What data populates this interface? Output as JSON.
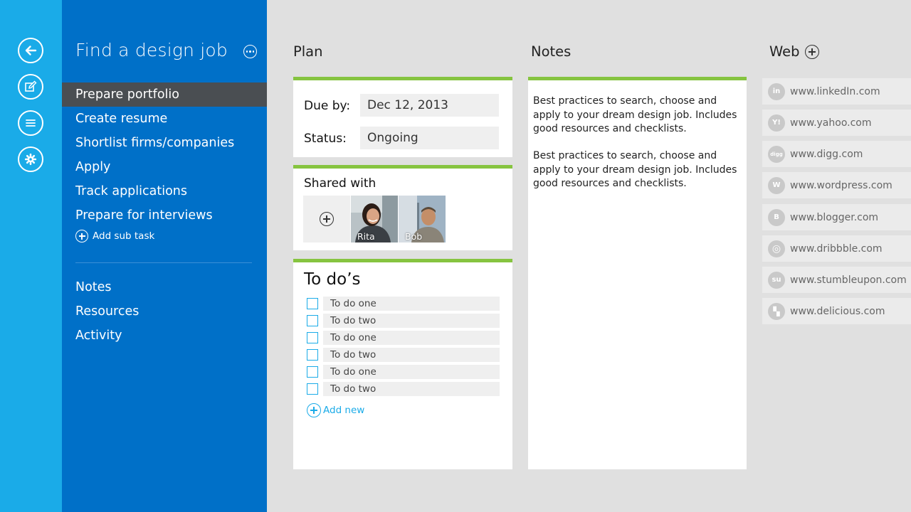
{
  "rail": {
    "buttons": [
      {
        "icon": "back-arrow-icon"
      },
      {
        "icon": "edit-icon"
      },
      {
        "icon": "list-icon"
      },
      {
        "icon": "settings-gear-icon"
      }
    ]
  },
  "nav": {
    "title": "Find a design job",
    "items": [
      {
        "label": "Prepare portfolio",
        "selected": true
      },
      {
        "label": "Create resume"
      },
      {
        "label": "Shortlist firms/companies"
      },
      {
        "label": "Apply"
      },
      {
        "label": "Track applications"
      },
      {
        "label": "Prepare for interviews"
      }
    ],
    "add_sub_task": "Add sub task",
    "secondary_items": [
      {
        "label": "Notes"
      },
      {
        "label": "Resources"
      },
      {
        "label": "Activity"
      }
    ]
  },
  "plan": {
    "title": "Plan",
    "due_label": "Due by:",
    "due_value": "Dec 12, 2013",
    "status_label": "Status:",
    "status_value": "Ongoing",
    "shared_title": "Shared with",
    "people": [
      {
        "name": "Rita"
      },
      {
        "name": "Bob"
      }
    ],
    "todo_title": "To do’s",
    "todos": [
      {
        "text": "To do one"
      },
      {
        "text": "To do two"
      },
      {
        "text": "To do one"
      },
      {
        "text": "To do two"
      },
      {
        "text": "To do one"
      },
      {
        "text": "To do two"
      }
    ],
    "add_new": "Add new"
  },
  "notes": {
    "title": "Notes",
    "paragraphs": [
      "Best practices to search, choose and apply to your dream design job. Includes good resources and checklists.",
      "Best practices to search, choose and apply to your dream design job. Includes good resources and checklists."
    ]
  },
  "web": {
    "title": "Web",
    "links": [
      {
        "icon": "linkedin-icon",
        "glyph": "in",
        "url": "www.linkedIn.com"
      },
      {
        "icon": "yahoo-icon",
        "glyph": "Y!",
        "url": "www.yahoo.com"
      },
      {
        "icon": "digg-icon",
        "glyph": "digg",
        "url": "www.digg.com"
      },
      {
        "icon": "wordpress-icon",
        "glyph": "W",
        "url": "www.wordpress.com"
      },
      {
        "icon": "blogger-icon",
        "glyph": "B",
        "url": "www.blogger.com"
      },
      {
        "icon": "dribbble-icon",
        "glyph": "◎",
        "url": "www.dribbble.com"
      },
      {
        "icon": "stumbleupon-icon",
        "glyph": "su",
        "url": "www.stumbleupon.com"
      },
      {
        "icon": "delicious-icon",
        "glyph": "▚",
        "url": "www.delicious.com"
      }
    ]
  },
  "colors": {
    "rail": "#1aabe8",
    "nav": "#0070c8",
    "selected": "#4a4e52",
    "card_accent": "#86c440",
    "link_blue": "#1aabe8",
    "background": "#e0e0e0"
  }
}
